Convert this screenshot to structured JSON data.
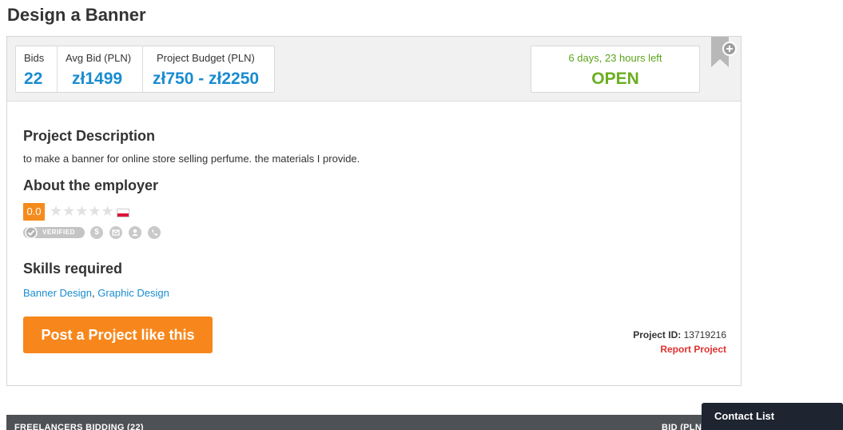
{
  "page": {
    "title": "Design a Banner"
  },
  "stats": {
    "bids_label": "Bids",
    "bids_value": "22",
    "avg_label": "Avg Bid (PLN)",
    "avg_value": "zł1499",
    "budget_label": "Project Budget (PLN)",
    "budget_value": "zł750 - zł2250"
  },
  "timer": {
    "time_left": "6 days, 23 hours left",
    "status": "OPEN"
  },
  "description": {
    "heading": "Project Description",
    "text": "to make a banner for online store selling perfume. the materials I provide."
  },
  "employer": {
    "heading": "About the employer",
    "rating": "0.0",
    "stars_filled": 0,
    "stars_total": 5,
    "stars": "★★★★★",
    "verified_label": "VERIFIED",
    "country_flag": "Poland"
  },
  "skills": {
    "heading": "Skills required",
    "items": [
      "Banner Design",
      "Graphic Design"
    ],
    "separator": ", "
  },
  "cta": {
    "label": "Post a Project like this"
  },
  "project": {
    "id_label": "Project ID:",
    "id_value": "13719216",
    "report_label": "Report Project"
  },
  "bidding_bar": {
    "left_label": "FREELANCERS BIDDING (22)",
    "right_label": "BID (PLN"
  },
  "contact_list": {
    "label": "Contact List"
  },
  "colors": {
    "accent_blue": "#1a8cd0",
    "open_green": "#6aae1f",
    "cta_orange": "#f7871c",
    "report_red": "#e03030"
  }
}
